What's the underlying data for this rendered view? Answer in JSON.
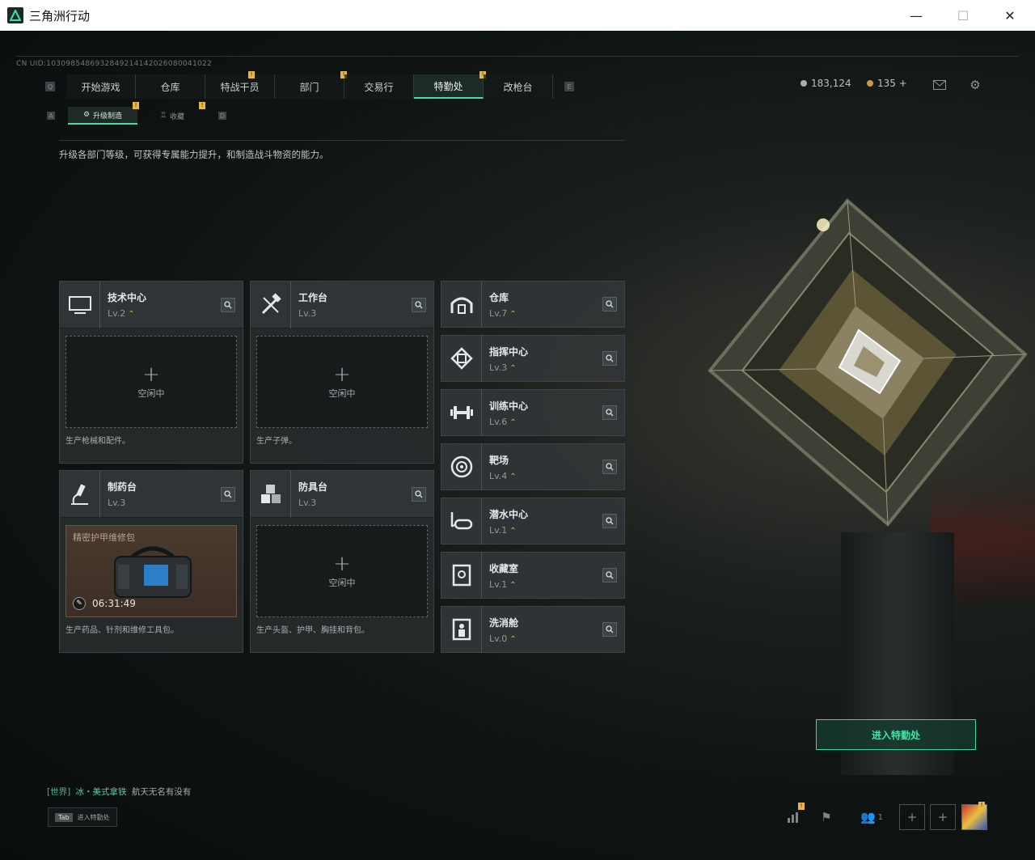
{
  "window": {
    "title": "三角洲行动",
    "minimize": "—",
    "maximize": "☐",
    "close": "✕"
  },
  "uid": "CN UID:1030985486932849214142026080041022",
  "nav": {
    "key_left": "Q",
    "key_right": "E",
    "items": [
      {
        "label": "开始游戏",
        "badge": ""
      },
      {
        "label": "仓库",
        "badge": ""
      },
      {
        "label": "特战干员",
        "badge": "!"
      },
      {
        "label": "部门",
        "badge": "!"
      },
      {
        "label": "交易行",
        "badge": ""
      },
      {
        "label": "特勤处",
        "badge": "!"
      },
      {
        "label": "改枪台",
        "badge": ""
      }
    ]
  },
  "subnav": {
    "key_left": "A",
    "key_right": "D",
    "items": [
      {
        "label": "升级制造",
        "badge": "!"
      },
      {
        "label": "收藏",
        "badge": "!"
      }
    ]
  },
  "currency": {
    "coins": "183,124",
    "tickets": "135 +"
  },
  "description": "升级各部门等级，可获得专属能力提升，和制造战斗物资的能力。",
  "cards": [
    {
      "name": "技术中心",
      "level": "Lv.2",
      "status": "空闲中",
      "desc": "生产枪械和配件。"
    },
    {
      "name": "工作台",
      "level": "Lv.3",
      "status": "空闲中",
      "desc": "生产子弹。"
    },
    {
      "name": "制药台",
      "level": "Lv.3",
      "item_name": "精密护甲维修包",
      "timer": "06:31:49",
      "desc": "生产药品、针剂和维修工具包。"
    },
    {
      "name": "防具台",
      "level": "Lv.3",
      "status": "空闲中",
      "desc": "生产头盔、护甲、胸挂和背包。"
    }
  ],
  "right_list": [
    {
      "name": "仓库",
      "level": "Lv.7"
    },
    {
      "name": "指挥中心",
      "level": "Lv.3"
    },
    {
      "name": "训练中心",
      "level": "Lv.6"
    },
    {
      "name": "靶场",
      "level": "Lv.4"
    },
    {
      "name": "潜水中心",
      "level": "Lv.1"
    },
    {
      "name": "收藏室",
      "level": "Lv.1"
    },
    {
      "name": "洗消舱",
      "level": "Lv.0"
    }
  ],
  "enter_button": "进入特勤处",
  "chat": {
    "channel": "[世界]",
    "user": "冰・美式拿铁",
    "message": "航天无名有没有"
  },
  "tab_hint": {
    "key": "Tab",
    "label": "进入特勤处"
  },
  "bottom": {
    "friends": "1"
  },
  "colors": {
    "accent": "#3de0a8",
    "badge": "#e9b64a",
    "upgrade": "#e0b24a"
  }
}
